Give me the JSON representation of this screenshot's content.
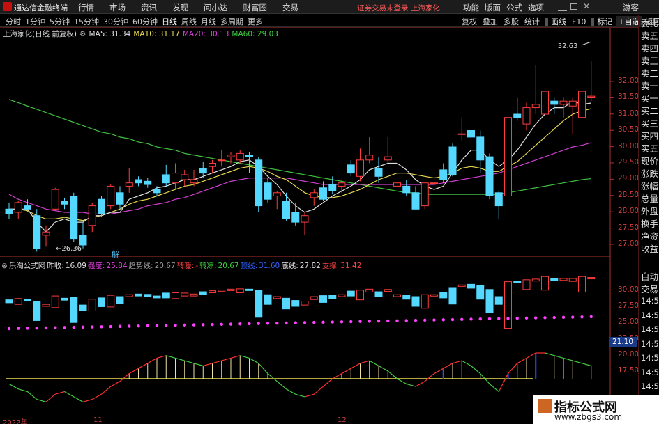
{
  "app": {
    "title": "通达信金融终端",
    "login_status": "证券交易未登录",
    "stock_short": "上海家化",
    "guest": "游客"
  },
  "menu": [
    "行情",
    "市场",
    "资讯",
    "发现",
    "问小达",
    "财富圈",
    "交易"
  ],
  "right_menu": [
    "功能",
    "版面",
    "公式",
    "选项"
  ],
  "period_tabs": [
    "分时",
    "1分钟",
    "5分钟",
    "15分钟",
    "30分钟",
    "60分钟",
    "日线",
    "周线",
    "月线",
    "多周期",
    "更多"
  ],
  "active_period": "日线",
  "toolbar": [
    "复权",
    "叠加",
    "多股",
    "统计",
    "画线",
    "F10",
    "标记",
    "+自选",
    "返回"
  ],
  "main_chart": {
    "title": "上海家化(日线 前复权)",
    "ma": [
      {
        "label": "MA5: 31.34",
        "color": "#e0e0e0"
      },
      {
        "label": "MA10: 31.17",
        "color": "#f0e050"
      },
      {
        "label": "MA20: 30.13",
        "color": "#e040e0"
      },
      {
        "label": "MA60: 29.03",
        "color": "#40d040"
      }
    ],
    "high_label": "32.63",
    "low_label": "26.36",
    "marker": "解",
    "y_ticks": [
      "32.00",
      "31.50",
      "31.00",
      "30.50",
      "30.00",
      "29.50",
      "29.00",
      "28.50",
      "28.00",
      "27.50",
      "27.00"
    ]
  },
  "indicator": {
    "name": "乐淘公式网",
    "fields": [
      {
        "label": "昨收:",
        "value": "16.09",
        "color": "#e0e0e0"
      },
      {
        "label": "强度:",
        "value": "25.84",
        "color": "#e040e0"
      },
      {
        "label": "趋势线:",
        "value": "20.67",
        "color": "#999999"
      },
      {
        "label": "转暖:",
        "value": "-",
        "color": "#ff4040"
      },
      {
        "label": "转凉:",
        "value": "20.67",
        "color": "#40d040"
      },
      {
        "label": "顶线:",
        "value": "31.60",
        "color": "#3060ff"
      },
      {
        "label": "底线:",
        "value": "27.82",
        "color": "#e0e0e0"
      },
      {
        "label": "支撑:",
        "value": "31.42",
        "color": "#ff4040"
      }
    ],
    "y_ticks": [
      "30.00",
      "27.50",
      "25.00",
      "22.50",
      "20.00",
      "17.50"
    ],
    "price_badge": "21.10"
  },
  "x_axis": [
    "2022年",
    "11",
    "12"
  ],
  "right_panel": [
    "委比",
    "卖五",
    "卖四",
    "卖三",
    "卖二",
    "卖一",
    "买一",
    "买二",
    "买三",
    "买四",
    "买五",
    "现价",
    "涨跌",
    "涨幅",
    "总量",
    "外盘",
    "换手",
    "净资",
    "收益",
    "自动",
    "交易",
    "14:56",
    "14:56",
    "14:56",
    "14:56",
    "14:56",
    "14:56",
    "14:56",
    "14:56"
  ],
  "watermark": {
    "line1": "指标公式网",
    "line2": "www.zbgs3.com"
  },
  "chart_data": {
    "type": "candlestick",
    "candles": [
      [
        28.1,
        28.3,
        27.8,
        27.95
      ],
      [
        28.0,
        28.35,
        27.8,
        28.3
      ],
      [
        28.2,
        28.4,
        28.0,
        28.1
      ],
      [
        27.9,
        28.1,
        26.8,
        26.9
      ],
      [
        27.3,
        27.6,
        26.95,
        27.4
      ],
      [
        28.1,
        28.75,
        28.05,
        28.7
      ],
      [
        28.35,
        28.45,
        28.1,
        28.25
      ],
      [
        28.5,
        28.6,
        27.1,
        27.2
      ],
      [
        27.3,
        27.7,
        26.9,
        27.0
      ],
      [
        27.6,
        28.3,
        27.4,
        28.2
      ],
      [
        28.4,
        28.5,
        27.85,
        27.95
      ],
      [
        28.2,
        28.85,
        28.1,
        28.8
      ],
      [
        28.6,
        28.8,
        28.1,
        28.25
      ],
      [
        28.8,
        29.35,
        28.6,
        28.9
      ],
      [
        29.0,
        29.1,
        28.8,
        28.9
      ],
      [
        28.95,
        29.05,
        28.75,
        28.85
      ],
      [
        28.7,
        28.8,
        28.5,
        28.6
      ],
      [
        29.15,
        29.45,
        28.8,
        28.9
      ],
      [
        28.9,
        29.5,
        28.7,
        29.2
      ],
      [
        29.0,
        29.3,
        28.8,
        29.15
      ],
      [
        28.9,
        29.3,
        28.8,
        29.0
      ],
      [
        29.35,
        29.55,
        29.05,
        29.2
      ],
      [
        29.4,
        29.6,
        29.2,
        29.5
      ],
      [
        29.6,
        29.9,
        29.4,
        29.6
      ],
      [
        29.7,
        29.85,
        29.5,
        29.75
      ],
      [
        29.6,
        29.9,
        29.5,
        29.8
      ],
      [
        29.75,
        29.85,
        29.2,
        29.7
      ],
      [
        29.6,
        29.7,
        28.0,
        28.2
      ],
      [
        28.9,
        29.05,
        28.3,
        28.4
      ],
      [
        28.5,
        28.65,
        28.1,
        28.6
      ],
      [
        28.35,
        28.6,
        27.75,
        27.8
      ],
      [
        28.0,
        28.3,
        27.6,
        27.7
      ],
      [
        27.7,
        28.0,
        27.3,
        27.9
      ],
      [
        28.45,
        28.7,
        28.2,
        28.6
      ],
      [
        28.75,
        28.95,
        28.35,
        28.4
      ],
      [
        28.85,
        29.1,
        28.55,
        28.65
      ],
      [
        28.8,
        29.0,
        28.6,
        28.9
      ],
      [
        29.45,
        29.6,
        29.1,
        29.2
      ],
      [
        29.1,
        29.95,
        28.95,
        29.6
      ],
      [
        29.6,
        30.3,
        29.5,
        29.75
      ],
      [
        29.35,
        29.7,
        28.9,
        29.1
      ],
      [
        29.6,
        30.3,
        29.5,
        29.7
      ],
      [
        28.8,
        29.2,
        28.75,
        28.9
      ],
      [
        28.8,
        29.0,
        28.5,
        28.6
      ],
      [
        28.6,
        28.8,
        28.1,
        28.1
      ],
      [
        28.2,
        28.9,
        28.1,
        28.9
      ],
      [
        28.9,
        29.6,
        28.7,
        28.9
      ],
      [
        29.3,
        29.5,
        28.9,
        29.0
      ],
      [
        30.0,
        30.1,
        29.1,
        29.15
      ],
      [
        30.4,
        30.9,
        30.2,
        30.4
      ],
      [
        30.5,
        30.8,
        30.2,
        30.3
      ],
      [
        30.3,
        30.5,
        29.2,
        29.6
      ],
      [
        29.7,
        29.8,
        28.4,
        28.5
      ],
      [
        28.6,
        28.65,
        27.8,
        28.2
      ],
      [
        28.5,
        31.1,
        28.4,
        30.9
      ],
      [
        31.0,
        31.5,
        30.8,
        30.9
      ],
      [
        30.7,
        31.35,
        30.5,
        31.2
      ],
      [
        31.2,
        32.5,
        31.0,
        31.3
      ],
      [
        31.0,
        31.8,
        30.4,
        31.7
      ],
      [
        31.4,
        31.5,
        31.0,
        31.3
      ],
      [
        31.3,
        31.5,
        30.9,
        31.4
      ],
      [
        31.25,
        31.5,
        30.4,
        31.4
      ],
      [
        30.9,
        31.9,
        30.8,
        31.7
      ],
      [
        31.5,
        32.63,
        31.4,
        31.55
      ]
    ],
    "ma5": [
      28.1,
      28.1,
      28.1,
      27.7,
      27.4,
      27.7,
      27.8,
      27.7,
      27.7,
      27.9,
      27.9,
      28.0,
      28.0,
      28.4,
      28.5,
      28.6,
      28.75,
      28.8,
      28.9,
      29.0,
      29.0,
      29.1,
      29.2,
      29.3,
      29.4,
      29.55,
      29.6,
      29.4,
      29.1,
      28.85,
      28.5,
      28.2,
      28.0,
      28.1,
      28.3,
      28.5,
      28.65,
      28.8,
      29.0,
      29.3,
      29.4,
      29.5,
      29.5,
      29.3,
      29.0,
      28.8,
      28.7,
      28.8,
      29.2,
      29.6,
      29.9,
      29.9,
      29.6,
      29.4,
      29.6,
      29.9,
      30.3,
      30.7,
      31.0,
      31.2,
      31.2,
      31.4,
      31.3,
      31.34
    ],
    "ma10": [
      28.1,
      28.1,
      28.05,
      27.9,
      27.8,
      27.8,
      27.85,
      27.8,
      27.75,
      27.85,
      27.9,
      28.0,
      28.1,
      28.25,
      28.35,
      28.4,
      28.5,
      28.6,
      28.7,
      28.8,
      28.85,
      28.95,
      29.05,
      29.15,
      29.25,
      29.35,
      29.4,
      29.35,
      29.25,
      29.1,
      29.0,
      28.8,
      28.6,
      28.5,
      28.45,
      28.45,
      28.5,
      28.6,
      28.7,
      28.85,
      29.0,
      29.1,
      29.2,
      29.2,
      29.15,
      29.1,
      29.05,
      29.1,
      29.2,
      29.35,
      29.4,
      29.35,
      29.25,
      29.25,
      29.4,
      29.55,
      29.8,
      30.05,
      30.3,
      30.55,
      30.8,
      31.0,
      31.1,
      31.17
    ],
    "ma20": [
      28.55,
      28.4,
      28.3,
      28.2,
      28.1,
      28.05,
      28.0,
      28.0,
      28.0,
      27.95,
      27.95,
      27.95,
      28.0,
      28.05,
      28.1,
      28.2,
      28.25,
      28.3,
      28.4,
      28.45,
      28.55,
      28.65,
      28.75,
      28.85,
      28.95,
      29.0,
      29.05,
      29.05,
      29.05,
      29.05,
      29.05,
      29.0,
      28.95,
      28.9,
      28.85,
      28.85,
      28.85,
      28.85,
      28.85,
      28.85,
      28.85,
      28.85,
      28.85,
      28.85,
      28.85,
      28.85,
      28.85,
      28.9,
      28.95,
      29.0,
      29.05,
      29.1,
      29.15,
      29.2,
      29.3,
      29.4,
      29.5,
      29.6,
      29.7,
      29.8,
      29.9,
      30.0,
      30.05,
      30.13
    ],
    "ma60": [
      31.45,
      31.35,
      31.25,
      31.15,
      31.05,
      30.95,
      30.85,
      30.75,
      30.65,
      30.55,
      30.45,
      30.4,
      30.3,
      30.25,
      30.15,
      30.1,
      30.0,
      29.95,
      29.9,
      29.8,
      29.75,
      29.7,
      29.65,
      29.6,
      29.55,
      29.5,
      29.45,
      29.4,
      29.35,
      29.3,
      29.25,
      29.2,
      29.15,
      29.1,
      29.05,
      29.0,
      28.95,
      28.9,
      28.85,
      28.8,
      28.75,
      28.7,
      28.65,
      28.6,
      28.6,
      28.55,
      28.55,
      28.55,
      28.55,
      28.55,
      28.55,
      28.55,
      28.55,
      28.55,
      28.6,
      28.65,
      28.7,
      28.75,
      28.8,
      28.85,
      28.9,
      28.95,
      29.0,
      29.03
    ],
    "osc": [
      -2,
      -4,
      -5,
      -8,
      -9,
      -6,
      -5,
      -7,
      -9,
      -8,
      -6,
      -3,
      -1,
      2,
      4,
      6,
      8,
      9,
      8,
      7,
      6,
      5,
      6,
      7,
      8,
      9,
      8,
      6,
      2,
      -1,
      -4,
      -6,
      -7,
      -6,
      -3,
      0,
      2,
      4,
      6,
      7,
      5,
      3,
      0,
      -2,
      -3,
      -1,
      2,
      4,
      6,
      7,
      5,
      2,
      -2,
      -5,
      2,
      6,
      8,
      10,
      10,
      9,
      8,
      7,
      6,
      5
    ]
  }
}
